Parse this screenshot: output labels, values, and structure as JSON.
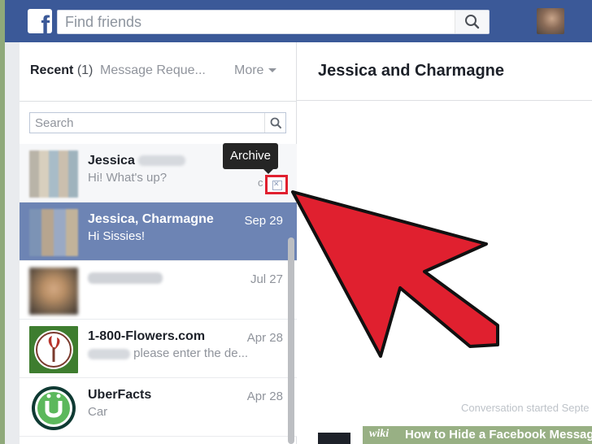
{
  "topbar": {
    "logo_letter": "f",
    "search_placeholder": "Find friends"
  },
  "inbox": {
    "tab_recent": "Recent",
    "tab_recent_count": "(1)",
    "tab_requests": "Message Reque...",
    "tab_more": "More",
    "search_placeholder": "Search"
  },
  "threads": [
    {
      "name": "Jessica",
      "snippet": "Hi! What's up?",
      "date": "",
      "state": "hover"
    },
    {
      "name": "Jessica, Charmagne",
      "snippet": "Hi Sissies!",
      "date": "Sep 29",
      "state": "selected"
    },
    {
      "name": "",
      "snippet": "",
      "date": "Jul 27",
      "state": "normal"
    },
    {
      "name": "1-800-Flowers.com",
      "snippet": "please enter the de...",
      "date": "Apr 28",
      "state": "normal"
    },
    {
      "name": "UberFacts",
      "snippet": "Car",
      "date": "Apr 28",
      "state": "normal"
    }
  ],
  "tooltip": {
    "label": "Archive"
  },
  "conversation": {
    "title": "Jessica and Charmagne",
    "started": "Conversation started Septe"
  },
  "watermark": {
    "brand": "wiki",
    "text": "How to Hide a Facebook Message"
  },
  "colors": {
    "facebook_blue": "#3b5998",
    "selected_row": "#6d84b4",
    "annotation_red": "#e0202f"
  }
}
